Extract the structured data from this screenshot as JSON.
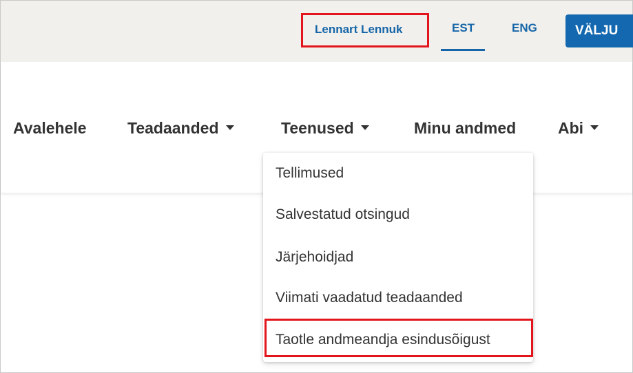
{
  "header": {
    "user_name": "Lennart Lennuk",
    "languages": [
      "EST",
      "ENG"
    ],
    "active_language": "EST",
    "logout_label": "VÄLJU"
  },
  "nav": {
    "home": "Avalehele",
    "notices": "Teadaanded",
    "services": "Teenused",
    "my_data": "Minu andmed",
    "help": "Abi"
  },
  "services_dropdown": {
    "items": [
      "Tellimused",
      "Salvestatud otsingud",
      "Järjehoidjad",
      "Viimati vaadatud teadaanded",
      "Taotle andmeandja esindusõigust"
    ]
  },
  "colors": {
    "accent": "#1468b0",
    "highlight": "#e3141b",
    "topbar_bg": "#f1f0ec"
  }
}
